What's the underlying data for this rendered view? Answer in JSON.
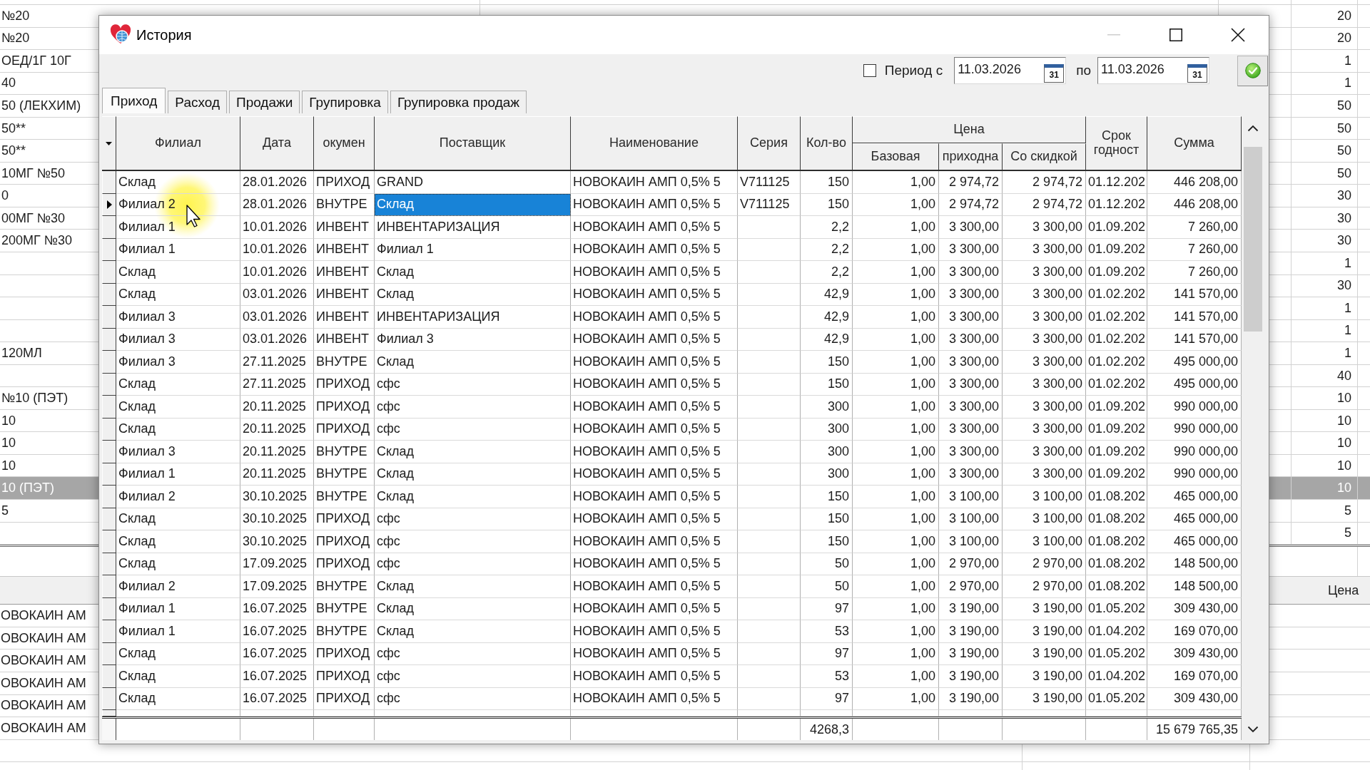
{
  "background_grid": {
    "rows": [
      {
        "column_1": "№20",
        "column_2": "20",
        "selected": false
      },
      {
        "column_1": "№20",
        "column_2": "20",
        "selected": false
      },
      {
        "column_1": "ОЕД/1Г 10Г",
        "column_2": "1",
        "selected": false
      },
      {
        "column_1": "40",
        "column_2": "1",
        "selected": false
      },
      {
        "column_1": "50 (ЛЕКХИМ)",
        "column_2": "50",
        "selected": false
      },
      {
        "column_1": "50**",
        "column_2": "50",
        "selected": false
      },
      {
        "column_1": "50**",
        "column_2": "50",
        "selected": false
      },
      {
        "column_1": "10МГ №50",
        "column_2": "50",
        "selected": false
      },
      {
        "column_1": "0",
        "column_2": "30",
        "selected": false
      },
      {
        "column_1": "00МГ №30",
        "column_2": "30",
        "selected": false
      },
      {
        "column_1": "200МГ №30",
        "column_2": "30",
        "selected": false
      },
      {
        "column_2": "1",
        "selected": false
      },
      {
        "column_2": "30",
        "selected": false
      },
      {
        "column_2": "1",
        "selected": false
      },
      {
        "column_2": "1",
        "selected": false
      },
      {
        "column_1": "120МЛ",
        "column_2": "1",
        "selected": false
      },
      {
        "column_2": "40",
        "selected": false
      },
      {
        "column_1": "№10 (ПЭТ)",
        "column_2": "10",
        "selected": false
      },
      {
        "column_1": "10",
        "column_2": "10",
        "selected": false
      },
      {
        "column_1": "10",
        "column_2": "10",
        "selected": false
      },
      {
        "column_1": "10",
        "column_2": "10",
        "selected": false
      },
      {
        "column_1": "10 (ПЭТ)",
        "column_2": "10",
        "selected": true
      },
      {
        "column_1": "5",
        "column_2": "5",
        "selected": false
      },
      {
        "column_2": "5",
        "selected": false
      }
    ]
  },
  "background_lower_grid": {
    "header": "Цена",
    "rows": [
      {
        "column_1": "ОВОКАИН АМ"
      },
      {
        "column_1": "ОВОКАИН АМ"
      },
      {
        "column_1": "ОВОКАИН АМ"
      },
      {
        "column_1": "ОВОКАИН АМ"
      },
      {
        "column_1": "ОВОКАИН АМ"
      },
      {
        "column_1": "ОВОКАИН АМ"
      }
    ]
  },
  "window": {
    "title": "История",
    "controls": [
      {
        "kind": "minimize",
        "disabled": true
      },
      {
        "kind": "maximize",
        "disabled": false
      },
      {
        "kind": "close",
        "disabled": false
      }
    ]
  },
  "filter": {
    "period": {
      "label": "Период с",
      "checked": false
    },
    "date_from": {
      "value": "11.03.2026",
      "calendar": "31"
    },
    "to_label": "по",
    "date_to": {
      "value": "11.03.2026",
      "calendar": "31"
    }
  },
  "tabs": [
    {
      "label": "Приход",
      "selected": true
    },
    {
      "label": "Расход",
      "selected": false
    },
    {
      "label": "Продажи",
      "selected": false
    },
    {
      "label": "Групировка",
      "selected": false
    },
    {
      "label": "Групировка продаж",
      "selected": false
    }
  ],
  "table": {
    "columns": [
      {
        "kind": "column",
        "label": "Филиал",
        "focused": false
      },
      {
        "kind": "column",
        "label": "Дата",
        "focused": false
      },
      {
        "kind": "column",
        "label": "окумен",
        "focused": false
      },
      {
        "kind": "column",
        "label": "Поставщик",
        "focused": true
      },
      {
        "kind": "column",
        "label": "Наименование",
        "focused": false
      },
      {
        "kind": "column",
        "label": "Серия",
        "focused": false
      },
      {
        "kind": "column",
        "label": "Кол-во",
        "focused": false,
        "total": "4268,3"
      },
      {
        "kind": "group",
        "label": "Цена",
        "columns": [
          {
            "label": "Базовая",
            "focused": false
          },
          {
            "label": "приходна",
            "focused": false
          },
          {
            "label": "Со скидкой",
            "focused": false
          }
        ]
      },
      {
        "kind": "column",
        "label": "Срок годност",
        "focused": false
      },
      {
        "kind": "column",
        "label": "Сумма",
        "focused": false,
        "total": "15 679 765,35"
      }
    ],
    "rows": [
      {
        "branch": "Склад",
        "date": "28.01.2026",
        "column_3": "ПРИХОД",
        "supplier": "GRAND",
        "name": "НОВОКАИН АМП 0,5% 5",
        "series": "V711125",
        "qty": "150",
        "base_price": "1,00",
        "column_10": "2 974,72",
        "discount_price": "2 974,72",
        "column_12": "01.12.202",
        "sum": "446 208,00",
        "selected": false
      },
      {
        "branch": "Филиал 2",
        "date": "28.01.2026",
        "column_3": "ВНУТРЕ",
        "supplier": "Склад",
        "name": "НОВОКАИН АМП 0,5% 5",
        "series": "V711125",
        "qty": "150",
        "base_price": "1,00",
        "column_10": "2 974,72",
        "discount_price": "2 974,72",
        "column_12": "01.12.202",
        "sum": "446 208,00",
        "selected": true
      },
      {
        "branch": "Филиал 1",
        "date": "10.01.2026",
        "column_3": "ИНВЕНТ",
        "supplier": "ИНВЕНТАРИЗАЦИЯ",
        "name": "НОВОКАИН АМП 0,5% 5",
        "qty": "2,2",
        "base_price": "1,00",
        "column_10": "3 300,00",
        "discount_price": "3 300,00",
        "column_12": "01.09.202",
        "sum": "7 260,00",
        "selected": false
      },
      {
        "branch": "Филиал 1",
        "date": "10.01.2026",
        "column_3": "ИНВЕНТ",
        "supplier": "Филиал 1",
        "name": "НОВОКАИН АМП 0,5% 5",
        "qty": "2,2",
        "base_price": "1,00",
        "column_10": "3 300,00",
        "discount_price": "3 300,00",
        "column_12": "01.09.202",
        "sum": "7 260,00",
        "selected": false
      },
      {
        "branch": "Склад",
        "date": "10.01.2026",
        "column_3": "ИНВЕНТ",
        "supplier": "Склад",
        "name": "НОВОКАИН АМП 0,5% 5",
        "qty": "2,2",
        "base_price": "1,00",
        "column_10": "3 300,00",
        "discount_price": "3 300,00",
        "column_12": "01.09.202",
        "sum": "7 260,00",
        "selected": false
      },
      {
        "branch": "Склад",
        "date": "03.01.2026",
        "column_3": "ИНВЕНТ",
        "supplier": "Склад",
        "name": "НОВОКАИН АМП 0,5% 5",
        "qty": "42,9",
        "base_price": "1,00",
        "column_10": "3 300,00",
        "discount_price": "3 300,00",
        "column_12": "01.02.202",
        "sum": "141 570,00",
        "selected": false
      },
      {
        "branch": "Филиал 3",
        "date": "03.01.2026",
        "column_3": "ИНВЕНТ",
        "supplier": "ИНВЕНТАРИЗАЦИЯ",
        "name": "НОВОКАИН АМП 0,5% 5",
        "qty": "42,9",
        "base_price": "1,00",
        "column_10": "3 300,00",
        "discount_price": "3 300,00",
        "column_12": "01.02.202",
        "sum": "141 570,00",
        "selected": false
      },
      {
        "branch": "Филиал 3",
        "date": "03.01.2026",
        "column_3": "ИНВЕНТ",
        "supplier": "Филиал 3",
        "name": "НОВОКАИН АМП 0,5% 5",
        "qty": "42,9",
        "base_price": "1,00",
        "column_10": "3 300,00",
        "discount_price": "3 300,00",
        "column_12": "01.02.202",
        "sum": "141 570,00",
        "selected": false
      },
      {
        "branch": "Филиал 3",
        "date": "27.11.2025",
        "column_3": "ВНУТРЕ",
        "supplier": "Склад",
        "name": "НОВОКАИН АМП 0,5% 5",
        "qty": "150",
        "base_price": "1,00",
        "column_10": "3 300,00",
        "discount_price": "3 300,00",
        "column_12": "01.02.202",
        "sum": "495 000,00",
        "selected": false
      },
      {
        "branch": "Склад",
        "date": "27.11.2025",
        "column_3": "ПРИХОД",
        "supplier": "сфс",
        "name": "НОВОКАИН АМП 0,5% 5",
        "qty": "150",
        "base_price": "1,00",
        "column_10": "3 300,00",
        "discount_price": "3 300,00",
        "column_12": "01.02.202",
        "sum": "495 000,00",
        "selected": false
      },
      {
        "branch": "Склад",
        "date": "20.11.2025",
        "column_3": "ПРИХОД",
        "supplier": "сфс",
        "name": "НОВОКАИН АМП 0,5% 5",
        "qty": "300",
        "base_price": "1,00",
        "column_10": "3 300,00",
        "discount_price": "3 300,00",
        "column_12": "01.09.202",
        "sum": "990 000,00",
        "selected": false
      },
      {
        "branch": "Склад",
        "date": "20.11.2025",
        "column_3": "ПРИХОД",
        "supplier": "сфс",
        "name": "НОВОКАИН АМП 0,5% 5",
        "qty": "300",
        "base_price": "1,00",
        "column_10": "3 300,00",
        "discount_price": "3 300,00",
        "column_12": "01.09.202",
        "sum": "990 000,00",
        "selected": false
      },
      {
        "branch": "Филиал 3",
        "date": "20.11.2025",
        "column_3": "ВНУТРЕ",
        "supplier": "Склад",
        "name": "НОВОКАИН АМП 0,5% 5",
        "qty": "300",
        "base_price": "1,00",
        "column_10": "3 300,00",
        "discount_price": "3 300,00",
        "column_12": "01.09.202",
        "sum": "990 000,00",
        "selected": false
      },
      {
        "branch": "Филиал 1",
        "date": "20.11.2025",
        "column_3": "ВНУТРЕ",
        "supplier": "Склад",
        "name": "НОВОКАИН АМП 0,5% 5",
        "qty": "300",
        "base_price": "1,00",
        "column_10": "3 300,00",
        "discount_price": "3 300,00",
        "column_12": "01.09.202",
        "sum": "990 000,00",
        "selected": false
      },
      {
        "branch": "Филиал 2",
        "date": "30.10.2025",
        "column_3": "ВНУТРЕ",
        "supplier": "Склад",
        "name": "НОВОКАИН АМП 0,5% 5",
        "qty": "150",
        "base_price": "1,00",
        "column_10": "3 100,00",
        "discount_price": "3 100,00",
        "column_12": "01.08.202",
        "sum": "465 000,00",
        "selected": false
      },
      {
        "branch": "Склад",
        "date": "30.10.2025",
        "column_3": "ПРИХОД",
        "supplier": "сфс",
        "name": "НОВОКАИН АМП 0,5% 5",
        "qty": "150",
        "base_price": "1,00",
        "column_10": "3 100,00",
        "discount_price": "3 100,00",
        "column_12": "01.08.202",
        "sum": "465 000,00",
        "selected": false
      },
      {
        "branch": "Склад",
        "date": "30.10.2025",
        "column_3": "ПРИХОД",
        "supplier": "сфс",
        "name": "НОВОКАИН АМП 0,5% 5",
        "qty": "150",
        "base_price": "1,00",
        "column_10": "3 100,00",
        "discount_price": "3 100,00",
        "column_12": "01.08.202",
        "sum": "465 000,00",
        "selected": false
      },
      {
        "branch": "Склад",
        "date": "17.09.2025",
        "column_3": "ПРИХОД",
        "supplier": "сфс",
        "name": "НОВОКАИН АМП 0,5% 5",
        "qty": "50",
        "base_price": "1,00",
        "column_10": "2 970,00",
        "discount_price": "2 970,00",
        "column_12": "01.08.202",
        "sum": "148 500,00",
        "selected": false
      },
      {
        "branch": "Филиал 2",
        "date": "17.09.2025",
        "column_3": "ВНУТРЕ",
        "supplier": "Склад",
        "name": "НОВОКАИН АМП 0,5% 5",
        "qty": "50",
        "base_price": "1,00",
        "column_10": "2 970,00",
        "discount_price": "2 970,00",
        "column_12": "01.08.202",
        "sum": "148 500,00",
        "selected": false
      },
      {
        "branch": "Филиал 1",
        "date": "16.07.2025",
        "column_3": "ВНУТРЕ",
        "supplier": "Склад",
        "name": "НОВОКАИН АМП 0,5% 5",
        "qty": "97",
        "base_price": "1,00",
        "column_10": "3 190,00",
        "discount_price": "3 190,00",
        "column_12": "01.05.202",
        "sum": "309 430,00",
        "selected": false
      },
      {
        "branch": "Филиал 1",
        "date": "16.07.2025",
        "column_3": "ВНУТРЕ",
        "supplier": "Склад",
        "name": "НОВОКАИН АМП 0,5% 5",
        "qty": "53",
        "base_price": "1,00",
        "column_10": "3 190,00",
        "discount_price": "3 190,00",
        "column_12": "01.04.202",
        "sum": "169 070,00",
        "selected": false
      },
      {
        "branch": "Склад",
        "date": "16.07.2025",
        "column_3": "ПРИХОД",
        "supplier": "сфс",
        "name": "НОВОКАИН АМП 0,5% 5",
        "qty": "97",
        "base_price": "1,00",
        "column_10": "3 190,00",
        "discount_price": "3 190,00",
        "column_12": "01.05.202",
        "sum": "309 430,00",
        "selected": false
      },
      {
        "branch": "Склад",
        "date": "16.07.2025",
        "column_3": "ПРИХОД",
        "supplier": "сфс",
        "name": "НОВОКАИН АМП 0,5% 5",
        "qty": "53",
        "base_price": "1,00",
        "column_10": "3 190,00",
        "discount_price": "3 190,00",
        "column_12": "01.04.202",
        "sum": "169 070,00",
        "selected": false
      },
      {
        "branch": "Склад",
        "date": "16.07.2025",
        "column_3": "ПРИХОД",
        "supplier": "сфс",
        "name": "НОВОКАИН АМП 0,5% 5",
        "qty": "97",
        "base_price": "1,00",
        "column_10": "3 190,00",
        "discount_price": "3 190,00",
        "column_12": "01.05.202",
        "sum": "309 430,00",
        "selected": false
      }
    ]
  }
}
